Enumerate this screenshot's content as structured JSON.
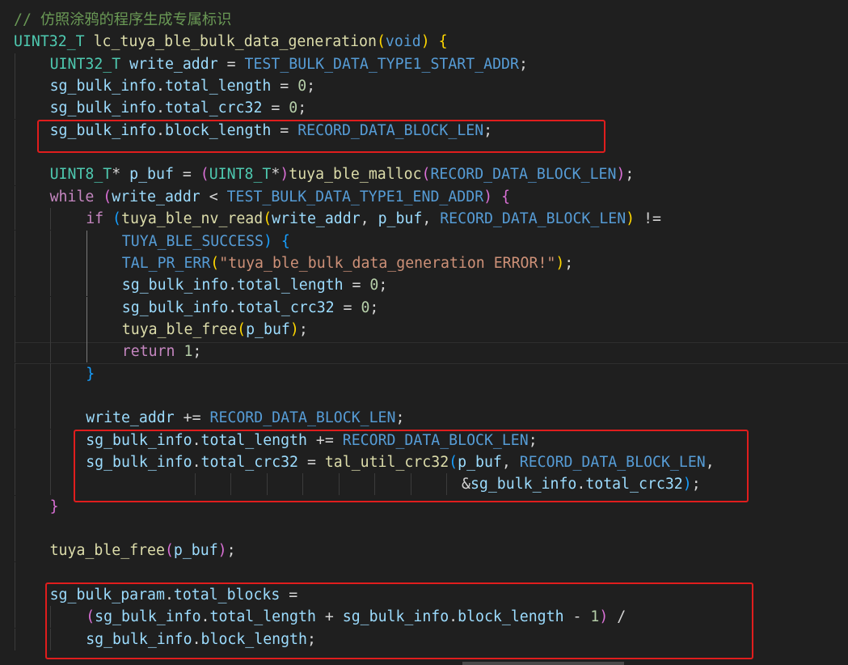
{
  "editor": {
    "theme": {
      "background": "#1f1f1f",
      "highlight_box": "#e01d1d"
    },
    "lines": [
      {
        "indent": 0,
        "tokens": [
          [
            "// 仿照涂鸦的程序生成专属标识",
            "com"
          ]
        ]
      },
      {
        "indent": 0,
        "tokens": [
          [
            "UINT32_T",
            "type"
          ],
          [
            " ",
            "op"
          ],
          [
            "lc_tuya_ble_bulk_data_generation",
            "fn"
          ],
          [
            "(",
            "p1"
          ],
          [
            "void",
            "kwb"
          ],
          [
            ")",
            "p1"
          ],
          [
            " ",
            "op"
          ],
          [
            "{",
            "p1"
          ]
        ]
      },
      {
        "indent": 1,
        "tokens": [
          [
            "UINT32_T",
            "type"
          ],
          [
            " ",
            "op"
          ],
          [
            "write_addr",
            "var"
          ],
          [
            " = ",
            "op"
          ],
          [
            "TEST_BULK_DATA_TYPE1_START_ADDR",
            "macd"
          ],
          [
            ";",
            "op"
          ]
        ]
      },
      {
        "indent": 1,
        "tokens": [
          [
            "sg_bulk_info",
            "var"
          ],
          [
            ".",
            "op"
          ],
          [
            "total_length",
            "var"
          ],
          [
            " = ",
            "op"
          ],
          [
            "0",
            "num"
          ],
          [
            ";",
            "op"
          ]
        ]
      },
      {
        "indent": 1,
        "tokens": [
          [
            "sg_bulk_info",
            "var"
          ],
          [
            ".",
            "op"
          ],
          [
            "total_crc32",
            "var"
          ],
          [
            " = ",
            "op"
          ],
          [
            "0",
            "num"
          ],
          [
            ";",
            "op"
          ]
        ]
      },
      {
        "indent": 1,
        "tokens": [
          [
            "sg_bulk_info",
            "var"
          ],
          [
            ".",
            "op"
          ],
          [
            "block_length",
            "var"
          ],
          [
            " = ",
            "op"
          ],
          [
            "RECORD_DATA_BLOCK_LEN",
            "macd"
          ],
          [
            ";",
            "op"
          ]
        ]
      },
      {
        "indent": 1,
        "tokens": []
      },
      {
        "indent": 1,
        "tokens": [
          [
            "UINT8_T",
            "type"
          ],
          [
            "* ",
            "op"
          ],
          [
            "p_buf",
            "var"
          ],
          [
            " = ",
            "op"
          ],
          [
            "(",
            "p2"
          ],
          [
            "UINT8_T",
            "type"
          ],
          [
            "*",
            "op"
          ],
          [
            ")",
            "p2"
          ],
          [
            "tuya_ble_malloc",
            "fn"
          ],
          [
            "(",
            "p2"
          ],
          [
            "RECORD_DATA_BLOCK_LEN",
            "macd"
          ],
          [
            ")",
            "p2"
          ],
          [
            ";",
            "op"
          ]
        ]
      },
      {
        "indent": 1,
        "tokens": [
          [
            "while",
            "kw"
          ],
          [
            " ",
            "op"
          ],
          [
            "(",
            "p2"
          ],
          [
            "write_addr",
            "var"
          ],
          [
            " < ",
            "op"
          ],
          [
            "TEST_BULK_DATA_TYPE1_END_ADDR",
            "macd"
          ],
          [
            ")",
            "p2"
          ],
          [
            " ",
            "op"
          ],
          [
            "{",
            "p2"
          ]
        ]
      },
      {
        "indent": 2,
        "tokens": [
          [
            "if",
            "kw"
          ],
          [
            " ",
            "op"
          ],
          [
            "(",
            "p3"
          ],
          [
            "tuya_ble_nv_read",
            "fn"
          ],
          [
            "(",
            "p1"
          ],
          [
            "write_addr",
            "var"
          ],
          [
            ", ",
            "op"
          ],
          [
            "p_buf",
            "var"
          ],
          [
            ", ",
            "op"
          ],
          [
            "RECORD_DATA_BLOCK_LEN",
            "macd"
          ],
          [
            ")",
            "p1"
          ],
          [
            " != ",
            "op"
          ]
        ]
      },
      {
        "indent": 3,
        "tokens": [
          [
            "TUYA_BLE_SUCCESS",
            "macd"
          ],
          [
            ")",
            "p3"
          ],
          [
            " ",
            "op"
          ],
          [
            "{",
            "p3"
          ]
        ]
      },
      {
        "indent": 3,
        "tokens": [
          [
            "TAL_PR_ERR",
            "macd"
          ],
          [
            "(",
            "p1"
          ],
          [
            "\"tuya_ble_bulk_data_generation ERROR!\"",
            "str"
          ],
          [
            ")",
            "p1"
          ],
          [
            ";",
            "op"
          ]
        ]
      },
      {
        "indent": 3,
        "tokens": [
          [
            "sg_bulk_info",
            "var"
          ],
          [
            ".",
            "op"
          ],
          [
            "total_length",
            "var"
          ],
          [
            " = ",
            "op"
          ],
          [
            "0",
            "num"
          ],
          [
            ";",
            "op"
          ]
        ]
      },
      {
        "indent": 3,
        "tokens": [
          [
            "sg_bulk_info",
            "var"
          ],
          [
            ".",
            "op"
          ],
          [
            "total_crc32",
            "var"
          ],
          [
            " = ",
            "op"
          ],
          [
            "0",
            "num"
          ],
          [
            ";",
            "op"
          ]
        ]
      },
      {
        "indent": 3,
        "tokens": [
          [
            "tuya_ble_free",
            "fn"
          ],
          [
            "(",
            "p1"
          ],
          [
            "p_buf",
            "var"
          ],
          [
            ")",
            "p1"
          ],
          [
            ";",
            "op"
          ]
        ]
      },
      {
        "indent": 3,
        "tokens": [
          [
            "return",
            "kw"
          ],
          [
            " ",
            "op"
          ],
          [
            "1",
            "num"
          ],
          [
            ";",
            "op"
          ]
        ]
      },
      {
        "indent": 2,
        "tokens": [
          [
            "}",
            "p3"
          ]
        ]
      },
      {
        "indent": 2,
        "tokens": []
      },
      {
        "indent": 2,
        "tokens": [
          [
            "write_addr",
            "var"
          ],
          [
            " += ",
            "op"
          ],
          [
            "RECORD_DATA_BLOCK_LEN",
            "macd"
          ],
          [
            ";",
            "op"
          ]
        ]
      },
      {
        "indent": 2,
        "tokens": [
          [
            "sg_bulk_info",
            "var"
          ],
          [
            ".",
            "op"
          ],
          [
            "total_length",
            "var"
          ],
          [
            " += ",
            "op"
          ],
          [
            "RECORD_DATA_BLOCK_LEN",
            "macd"
          ],
          [
            ";",
            "op"
          ]
        ]
      },
      {
        "indent": 2,
        "tokens": [
          [
            "sg_bulk_info",
            "var"
          ],
          [
            ".",
            "op"
          ],
          [
            "total_crc32",
            "var"
          ],
          [
            " = ",
            "op"
          ],
          [
            "tal_util_crc32",
            "fn"
          ],
          [
            "(",
            "p3"
          ],
          [
            "p_buf",
            "var"
          ],
          [
            ", ",
            "op"
          ],
          [
            "RECORD_DATA_BLOCK_LEN",
            "macd"
          ],
          [
            ",",
            "op"
          ]
        ]
      },
      {
        "indent": 2,
        "tokens": [
          [
            "&",
            "op"
          ],
          [
            "sg_bulk_info",
            "var"
          ],
          [
            ".",
            "op"
          ],
          [
            "total_crc32",
            "var"
          ],
          [
            ")",
            "p3"
          ],
          [
            ";",
            "op"
          ]
        ]
      },
      {
        "indent": 1,
        "tokens": [
          [
            "}",
            "p2"
          ]
        ]
      },
      {
        "indent": 1,
        "tokens": []
      },
      {
        "indent": 1,
        "tokens": [
          [
            "tuya_ble_free",
            "fn"
          ],
          [
            "(",
            "p2"
          ],
          [
            "p_buf",
            "var"
          ],
          [
            ")",
            "p2"
          ],
          [
            ";",
            "op"
          ]
        ]
      },
      {
        "indent": 1,
        "tokens": []
      },
      {
        "indent": 1,
        "tokens": [
          [
            "sg_bulk_param",
            "var"
          ],
          [
            ".",
            "op"
          ],
          [
            "total_blocks",
            "var"
          ],
          [
            " =",
            "op"
          ]
        ]
      },
      {
        "indent": 2,
        "tokens": [
          [
            "(",
            "p2"
          ],
          [
            "sg_bulk_info",
            "var"
          ],
          [
            ".",
            "op"
          ],
          [
            "total_length",
            "var"
          ],
          [
            " + ",
            "op"
          ],
          [
            "sg_bulk_info",
            "var"
          ],
          [
            ".",
            "op"
          ],
          [
            "block_length",
            "var"
          ],
          [
            " - ",
            "op"
          ],
          [
            "1",
            "num"
          ],
          [
            ")",
            "p2"
          ],
          [
            " /",
            "op"
          ]
        ]
      },
      {
        "indent": 2,
        "tokens": [
          [
            "sg_bulk_info",
            "var"
          ],
          [
            ".",
            "op"
          ],
          [
            "block_length",
            "var"
          ],
          [
            ";",
            "op"
          ]
        ]
      }
    ]
  }
}
